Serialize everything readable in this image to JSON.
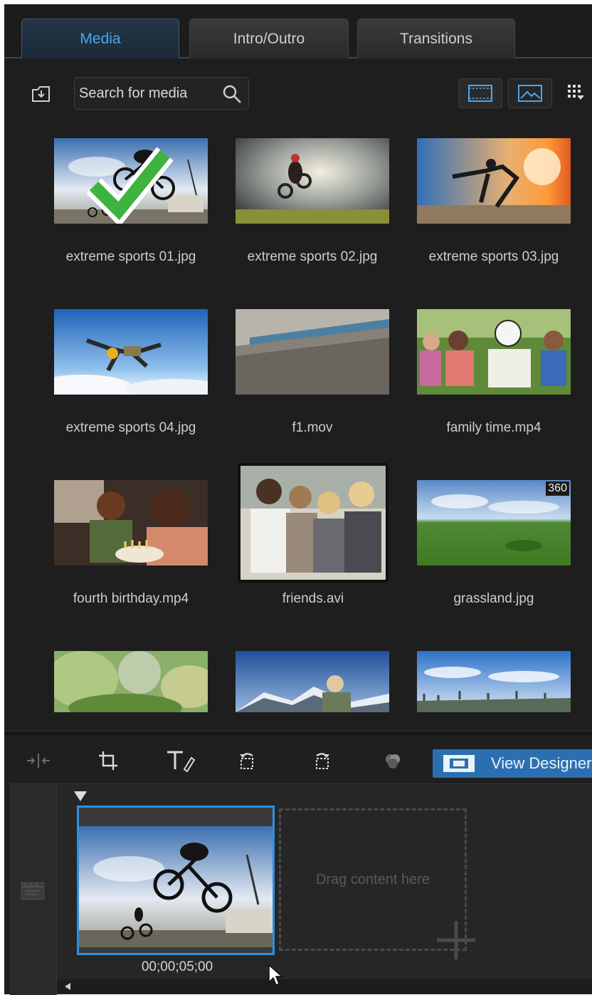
{
  "tabs": [
    {
      "label": "Media",
      "active": true
    },
    {
      "label": "Intro/Outro",
      "active": false
    },
    {
      "label": "Transitions",
      "active": false
    }
  ],
  "toolbar": {
    "import_icon": "import-media-icon",
    "search_placeholder": "Search for media",
    "search_icon": "search-icon",
    "view_buttons": [
      "filmstrip-view-icon",
      "image-view-icon"
    ],
    "menu_icon": "grid-menu-icon"
  },
  "media": [
    {
      "name": "extreme sports 01.jpg",
      "selected": true
    },
    {
      "name": "extreme sports 02.jpg"
    },
    {
      "name": "extreme sports 03.jpg"
    },
    {
      "name": "extreme sports 04.jpg"
    },
    {
      "name": "f1.mov"
    },
    {
      "name": "family time.mp4"
    },
    {
      "name": "fourth birthday.mp4"
    },
    {
      "name": "friends.avi"
    },
    {
      "name": "grassland.jpg",
      "badge": "360"
    },
    {
      "name": ""
    },
    {
      "name": ""
    },
    {
      "name": ""
    }
  ],
  "edit_toolbar": {
    "icons": [
      "split-icon",
      "crop-icon",
      "title-edit-icon",
      "rotate-left-icon",
      "rotate-right-icon",
      "fix-enhance-icon"
    ],
    "view_designer_label": "View Designer"
  },
  "timeline": {
    "clip_timecode": "00;00;05;00",
    "drop_hint": "Drag content here"
  },
  "colors": {
    "accent": "#2f8fe0",
    "active_tab_text": "#4ea6ea",
    "view_designer_bg": "#2c6fb0"
  }
}
